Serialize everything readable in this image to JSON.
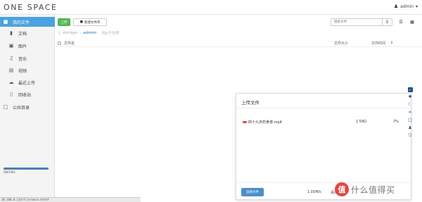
{
  "header": {
    "logo": "ONE SPACE",
    "user_name": "admin"
  },
  "sidebar": {
    "items": [
      {
        "label": "我的文件",
        "icon": "folder-icon",
        "active": true
      },
      {
        "label": "文档",
        "icon": "document-icon"
      },
      {
        "label": "图片",
        "icon": "image-icon"
      },
      {
        "label": "音乐",
        "icon": "music-icon"
      },
      {
        "label": "视频",
        "icon": "video-icon"
      },
      {
        "label": "最近上传",
        "icon": "cloud-upload-icon"
      },
      {
        "label": "回收站",
        "icon": "trash-icon"
      },
      {
        "label": "公共目录",
        "icon": "folder-open-icon"
      }
    ],
    "quota_text": "0B/18G",
    "status_url": "10.168.0.114/file/main.html#"
  },
  "toolbar": {
    "upload_label": "上传",
    "new_folder_label": "新建文件夹",
    "search_placeholder": "搜索文件"
  },
  "breadcrumb": {
    "root": "storage",
    "folder": "admin",
    "count": "共0个文件"
  },
  "table": {
    "col_name": "文件名",
    "col_size": "文件大小",
    "col_time": "文件时间"
  },
  "upload_panel": {
    "title": "上传文件",
    "file_name": "四十九天的食谱.mp4",
    "file_size": "1.59G",
    "percent": "7%",
    "select_button": "选择文件",
    "speed": "1.01M/s",
    "close_label": "关闭"
  },
  "watermark": {
    "logo": "值",
    "text": "什么值得买"
  },
  "colors": {
    "accent": "#4aa3df",
    "upload_green": "#5cb85c",
    "select_blue": "#4a90c9",
    "tool_blue": "#1f4e8a"
  }
}
